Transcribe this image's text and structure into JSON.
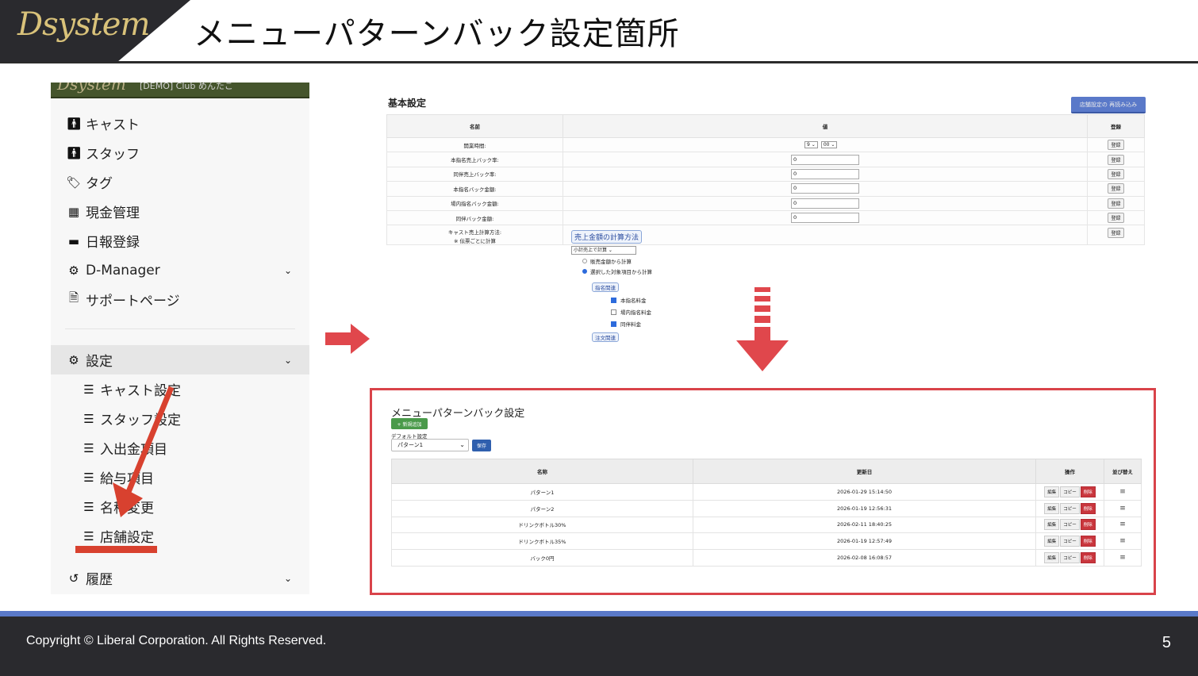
{
  "header": {
    "logo": "Dsystem",
    "title": "メニューパターンバック設定箇所"
  },
  "sidebar": {
    "top_logo": "Dsystem",
    "top_cut_text": "[DEMO] Club めんたこ",
    "items": [
      {
        "label": "キャスト",
        "icon": "person-icon"
      },
      {
        "label": "スタッフ",
        "icon": "person-icon"
      },
      {
        "label": "タグ",
        "icon": "tags-icon"
      },
      {
        "label": "現金管理",
        "icon": "calculator-icon"
      },
      {
        "label": "日報登録",
        "icon": "calendar-icon"
      },
      {
        "label": "D-Manager",
        "icon": "gear-icon"
      },
      {
        "label": "サポートページ",
        "icon": "file-icon"
      }
    ],
    "settings_label": "設定",
    "sub_items": [
      {
        "label": "キャスト設定"
      },
      {
        "label": "スタッフ設定"
      },
      {
        "label": "入出金項目"
      },
      {
        "label": "給与項目"
      },
      {
        "label": "名称変更"
      },
      {
        "label": "店舗設定"
      }
    ],
    "history_label": "履歴"
  },
  "basic": {
    "title": "基本設定",
    "reload_button": "店舗設定の 再読み込み",
    "columns": {
      "name": "名前",
      "value": "値",
      "action": "登録"
    },
    "open_time": {
      "label": "開業時間:",
      "hour": "9",
      "minute": "00"
    },
    "rows": [
      {
        "label": "本指名売上バック率:",
        "value": "0"
      },
      {
        "label": "同伴売上バック率:",
        "value": "0"
      },
      {
        "label": "本指名バック金額:",
        "value": "0"
      },
      {
        "label": "場内指名バック金額:",
        "value": "0"
      },
      {
        "label": "同伴バック金額:",
        "value": "0"
      }
    ],
    "register_label": "登録",
    "calc": {
      "label_line1": "キャスト売上計算方法:",
      "label_line2": "※ 伝票ごとに計算",
      "heading": "売上金額の計算方法",
      "select": "小計売上で計算",
      "radio1": "販売金額から計算",
      "radio2": "選択した対象項目から計算",
      "group1": "指名関連",
      "check1": "本指名料金",
      "check2": "場内指名料金",
      "check3": "同伴料金",
      "group2": "注文関連"
    }
  },
  "pattern": {
    "title": "メニューパターンバック設定",
    "new_button": "+ 新規追加",
    "default_label": "デフォルト設定",
    "default_value": "パターン1",
    "save_button": "保存",
    "columns": {
      "name": "名称",
      "updated": "更新日",
      "ops": "操作",
      "sort": "並び替え"
    },
    "ops_labels": {
      "edit": "編集",
      "copy": "コピー",
      "delete": "削除"
    },
    "rows": [
      {
        "name": "パターン1",
        "updated": "2026-01-29 15:14:50"
      },
      {
        "name": "パターン2",
        "updated": "2026-01-19 12:56:31"
      },
      {
        "name": "ドリンクボトル30%",
        "updated": "2026-02-11 18:40:25"
      },
      {
        "name": "ドリンクボトル35%",
        "updated": "2026-01-19 12:57:49"
      },
      {
        "name": "バック0円",
        "updated": "2026-02-08 16:08:57"
      }
    ]
  },
  "footer": {
    "copyright": "Copyright ©  Liberal Corporation. All Rights Reserved.",
    "page_number": "5"
  },
  "colors": {
    "highlight_red": "#d9434a",
    "footer_dark": "#2a2a2e",
    "accent_blue": "#5a79c9"
  }
}
